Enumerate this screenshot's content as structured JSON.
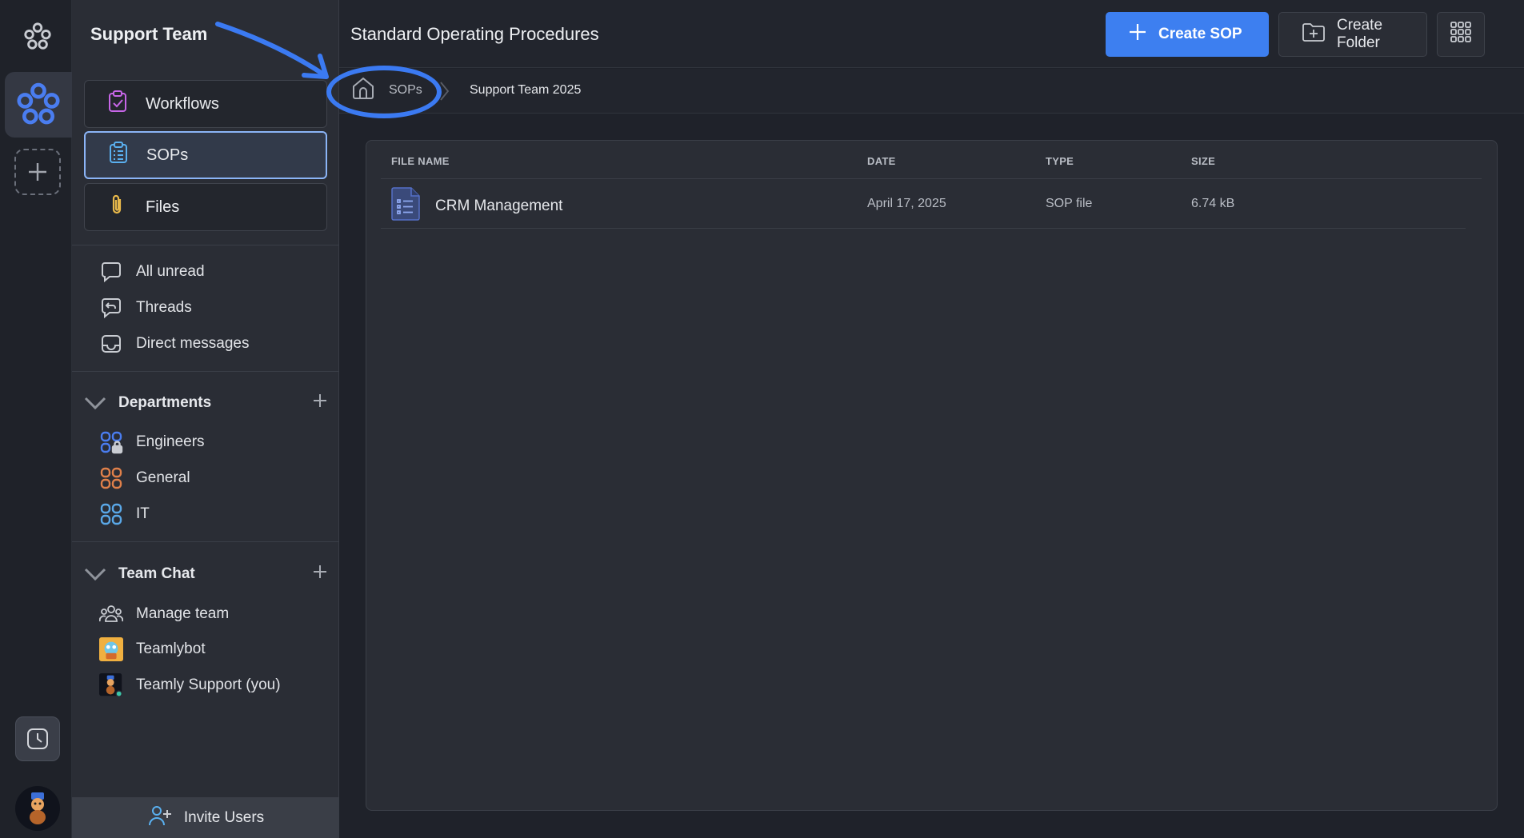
{
  "sidebar": {
    "team_name": "Support Team",
    "nav": [
      {
        "label": "Workflows",
        "icon": "clipboard-check-icon"
      },
      {
        "label": "SOPs",
        "icon": "clipboard-list-icon",
        "active": true
      },
      {
        "label": "Files",
        "icon": "paperclip-icon"
      }
    ],
    "quick": [
      {
        "label": "All unread",
        "icon": "chat-bubble-icon"
      },
      {
        "label": "Threads",
        "icon": "reply-bubble-icon"
      },
      {
        "label": "Direct messages",
        "icon": "inbox-icon"
      }
    ],
    "departments": {
      "title": "Departments",
      "items": [
        {
          "label": "Engineers",
          "icon": "channel-locked-icon",
          "color": "#4a7df0"
        },
        {
          "label": "General",
          "icon": "channel-icon",
          "color": "#e0804a"
        },
        {
          "label": "IT",
          "icon": "channel-icon",
          "color": "#5aa8e8"
        }
      ]
    },
    "team_chat": {
      "title": "Team Chat",
      "items": [
        {
          "label": "Manage team",
          "icon": "people-icon"
        },
        {
          "label": "Teamlybot",
          "icon": "bot-avatar"
        },
        {
          "label": "Teamly Support (you)",
          "icon": "user-avatar"
        }
      ]
    },
    "invite_label": "Invite Users"
  },
  "main": {
    "title": "Standard Operating Procedures",
    "create_sop_label": "Create SOP",
    "create_folder_label": "Create Folder",
    "breadcrumb": {
      "root": "SOPs",
      "current": "Support Team 2025"
    },
    "table": {
      "columns": [
        "FILE NAME",
        "DATE",
        "TYPE",
        "SIZE"
      ],
      "rows": [
        {
          "name": "CRM Management",
          "date": "April 17, 2025",
          "type": "SOP file",
          "size": "6.74 kB"
        }
      ]
    }
  },
  "colors": {
    "accent": "#3d7ff0",
    "active_border": "#8bb4f6",
    "annotation": "#3b7af2"
  }
}
